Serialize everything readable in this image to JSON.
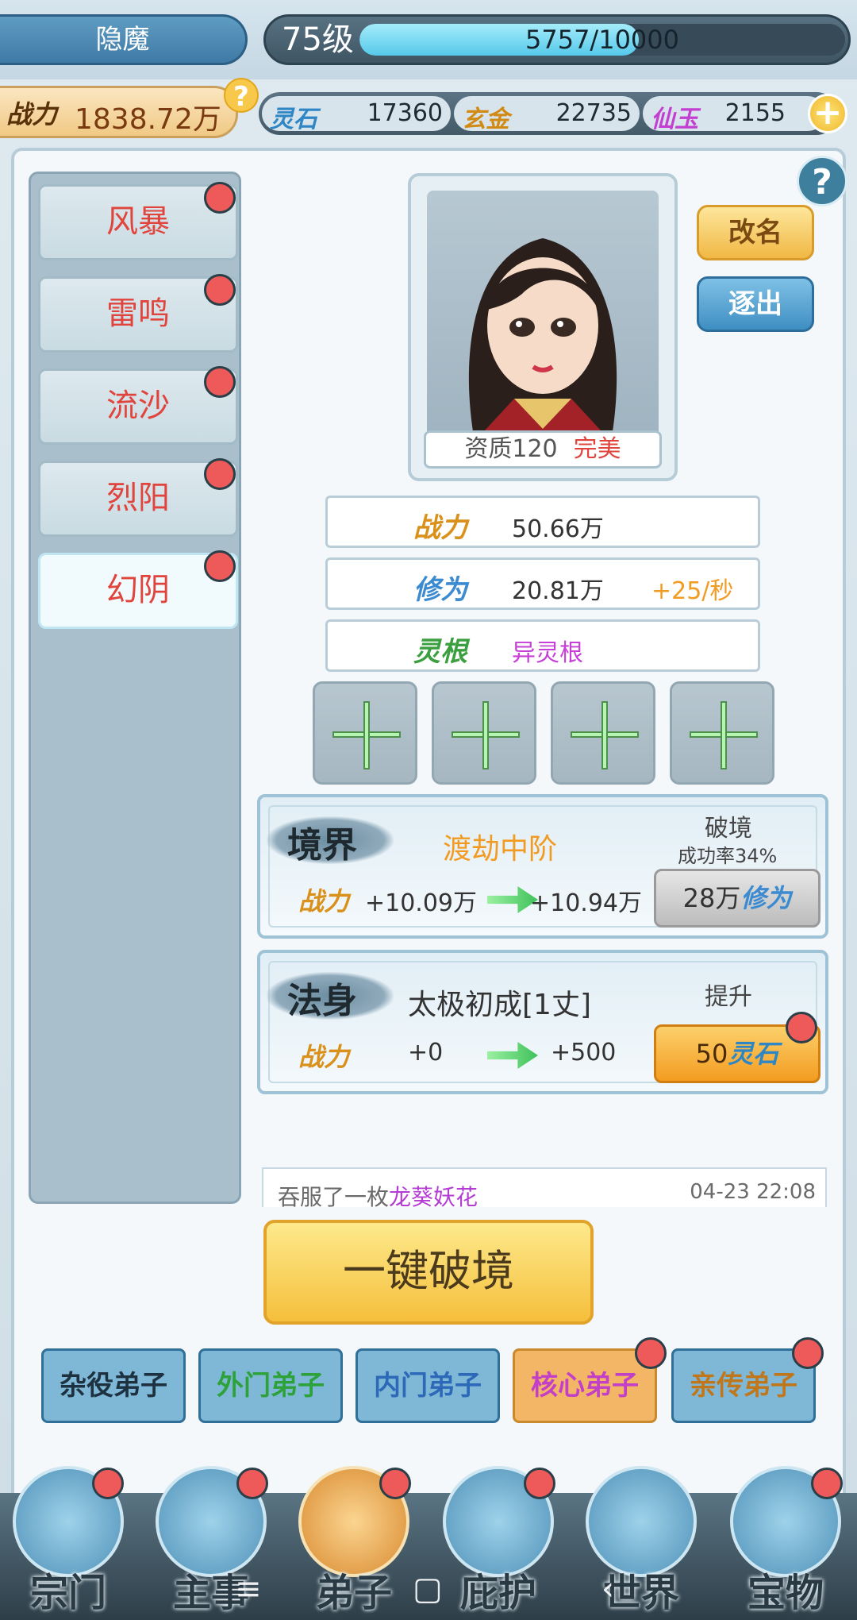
{
  "header": {
    "player_name": "隐魔",
    "level": "75级",
    "xp_text": "5757/10000",
    "xp_progress": 0.5757,
    "power_label": "战力",
    "power_value": "1838.72万",
    "help": "?"
  },
  "resources": [
    {
      "label": "灵石",
      "value": "17360",
      "color": "#2f86c5"
    },
    {
      "label": "玄金",
      "value": "22735",
      "color": "#d18a14"
    },
    {
      "label": "仙玉",
      "value": "2155",
      "color": "#c23fd0"
    }
  ],
  "sidebar": {
    "items": [
      {
        "label": "风暴",
        "badge": true
      },
      {
        "label": "雷鸣",
        "badge": true
      },
      {
        "label": "流沙",
        "badge": true
      },
      {
        "label": "烈阳",
        "badge": true
      },
      {
        "label": "幻阴",
        "badge": true,
        "active": true
      }
    ]
  },
  "disciple": {
    "aptitude_label": "资质120",
    "quality": "完美",
    "rename": "改名",
    "expel": "逐出",
    "stats": [
      {
        "label": "战力",
        "value": "50.66万",
        "extra": "",
        "color": "#d9911b"
      },
      {
        "label": "修为",
        "value": "20.81万",
        "extra": "+25/秒",
        "color": "#3c8bd1"
      },
      {
        "label": "灵根",
        "value": "异灵根",
        "extra": "",
        "color": "#3c9f3f",
        "value_color": "#c63fd6"
      }
    ]
  },
  "realm_card": {
    "title": "境界",
    "stage": "渡劫中阶",
    "action": "破境",
    "success_rate": "成功率34%",
    "power_label": "战力",
    "from": "+10.09万",
    "to": "+10.94万",
    "cost_amount": "28万",
    "cost_unit": "修为"
  },
  "body_card": {
    "title": "法身",
    "stage": "太极初成[1丈]",
    "action": "提升",
    "power_label": "战力",
    "from": "+0",
    "to": "+500",
    "cost_amount": "50",
    "cost_unit": "灵石"
  },
  "log": {
    "prefix": "吞服了一枚",
    "item": "龙葵妖花",
    "time": "04-23 22:08"
  },
  "main_button": "一键破境",
  "disciple_tabs": [
    {
      "label": "杂役弟子",
      "color": "#1d3140",
      "bg": "#7fb8d6",
      "badge": false
    },
    {
      "label": "外门弟子",
      "color": "#2ea23a",
      "bg": "#7fb8d6",
      "badge": false
    },
    {
      "label": "内门弟子",
      "color": "#2d69b8",
      "bg": "#7fb8d6",
      "badge": false
    },
    {
      "label": "核心弟子",
      "color": "#c23fc7",
      "bg": "#f3b667",
      "badge": true
    },
    {
      "label": "亲传弟子",
      "color": "#c0761a",
      "bg": "#7fb8d6",
      "badge": true
    }
  ],
  "bottom_nav": [
    {
      "label": "宗门",
      "icon": "sect-icon"
    },
    {
      "label": "主事",
      "icon": "task-icon"
    },
    {
      "label": "弟子",
      "icon": "disciple-icon",
      "active": true
    },
    {
      "label": "庇护",
      "icon": "shelter-icon"
    },
    {
      "label": "世界",
      "icon": "world-icon"
    },
    {
      "label": "宝物",
      "icon": "treasure-icon"
    }
  ],
  "system_nav": {
    "menu": "≡",
    "home": "▢",
    "back": "‹"
  }
}
